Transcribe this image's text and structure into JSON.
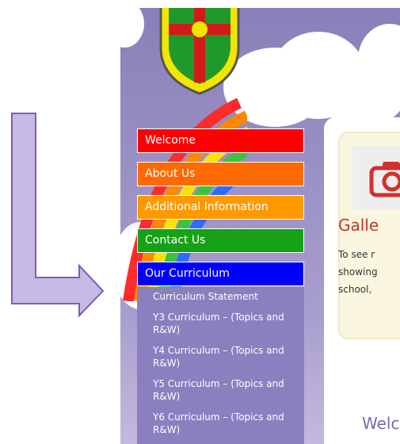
{
  "nav": {
    "items": [
      {
        "label": "Welcome",
        "color": "#ff0000"
      },
      {
        "label": "About Us",
        "color": "#ff6a00"
      },
      {
        "label": "Additional Information",
        "color": "#ff9900"
      },
      {
        "label": "Contact Us",
        "color": "#17a117"
      },
      {
        "label": "Our Curriculum",
        "color": "#0000ff"
      }
    ],
    "submenu": [
      "Curriculum Statement",
      "Y3 Curriculum – (Topics and R&W)",
      "Y4 Curriculum – (Topics and R&W)",
      "Y5 Curriculum – (Topics and R&W)",
      "Y6 Curriculum – (Topics and R&W)"
    ]
  },
  "content": {
    "gallery_icon": "camera-icon",
    "gallery_title": "Galle",
    "gallery_lines": [
      "To see r",
      "showing",
      "school,"
    ],
    "welcome": "Welc"
  },
  "colors": {
    "accent_red": "#c0392b",
    "panel_purple": "#8a7fb8",
    "arrow_purple": "#c6b9e3"
  }
}
